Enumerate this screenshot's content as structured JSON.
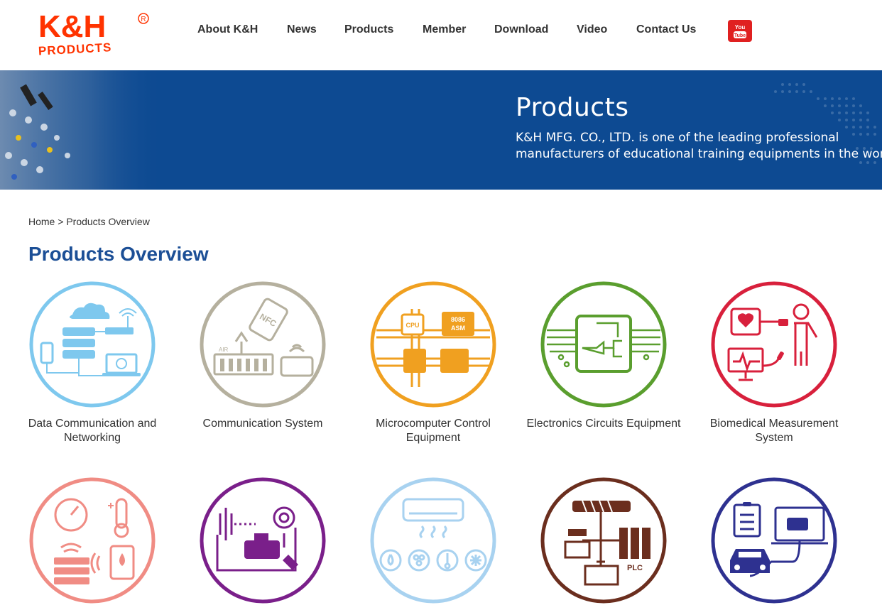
{
  "logo": {
    "text_top": "K&H",
    "text_bottom": "PRODUCTS",
    "mark": "®",
    "color": "#ff3300"
  },
  "nav": {
    "items": [
      {
        "label": "About K&H"
      },
      {
        "label": "News"
      },
      {
        "label": "Products"
      },
      {
        "label": "Member"
      },
      {
        "label": "Download"
      },
      {
        "label": "Video"
      },
      {
        "label": "Contact Us"
      }
    ],
    "youtube": {
      "line1": "You",
      "line2": "Tube",
      "icon": "youtube-icon"
    }
  },
  "banner": {
    "title": "Products",
    "desc_line1": "K&H MFG. CO., LTD. is one of the leading professional",
    "desc_line2": "manufacturers of educational training equipments in the world.",
    "bg_color": "#0d4a92"
  },
  "breadcrumb": {
    "home": "Home",
    "separator": ">",
    "current": "Products Overview"
  },
  "page_title": "Products Overview",
  "products": [
    {
      "label": "Data Communication and Networking",
      "color": "#7ec8ee",
      "icon": "network-icon"
    },
    {
      "label": "Communication System",
      "color": "#b5b09e",
      "icon": "nfc-icon"
    },
    {
      "label": "Microcomputer Control Equipment",
      "color": "#f0a020",
      "icon": "cpu-icon",
      "chip1": "CPU",
      "chip2a": "8086",
      "chip2b": "ASM"
    },
    {
      "label": "Electronics Circuits Equipment",
      "color": "#5a9e2e",
      "icon": "circuit-icon"
    },
    {
      "label": "Biomedical Measurement System",
      "color": "#d8203c",
      "icon": "biomedical-icon"
    },
    {
      "label": "",
      "color": "#f08c84",
      "icon": "sensor-icon"
    },
    {
      "label": "",
      "color": "#7a1f8a",
      "icon": "engine-icon"
    },
    {
      "label": "",
      "color": "#a8d2f0",
      "icon": "air-conditioner-icon"
    },
    {
      "label": "",
      "color": "#6b2e1e",
      "icon": "plc-icon",
      "plc": "PLC"
    },
    {
      "label": "",
      "color": "#2e3190",
      "icon": "car-diagnostic-icon"
    }
  ]
}
